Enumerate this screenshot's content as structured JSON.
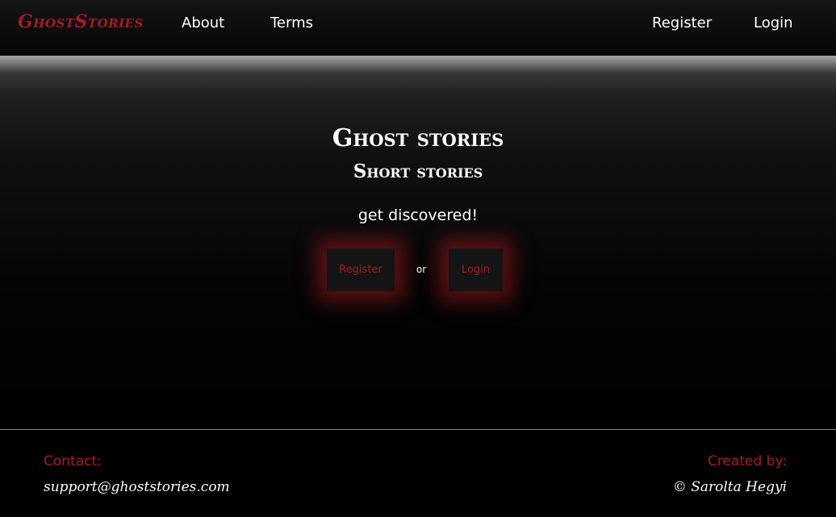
{
  "nav": {
    "brand": "GhostStories",
    "links": [
      "About",
      "Terms"
    ],
    "auth_links": [
      "Register",
      "Login"
    ]
  },
  "hero": {
    "title": "Ghost stories",
    "subtitle": "Short stories",
    "tagline": "get discovered!",
    "register_button": "Register",
    "or_text": "or",
    "login_button": "Login"
  },
  "footer": {
    "contact_label": "Contact:",
    "contact_email": "support@ghoststories.com",
    "created_label": "Created by:",
    "created_value": "© Sarolta Hegyi"
  },
  "colors": {
    "accent": "#a51d22",
    "background": "#000000",
    "text": "#ffffff"
  }
}
